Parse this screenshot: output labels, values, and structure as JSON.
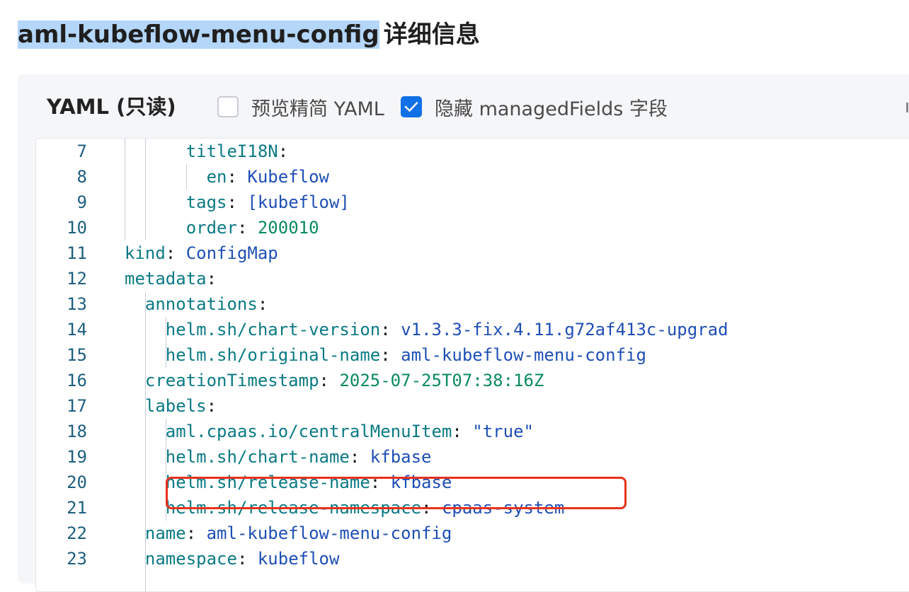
{
  "page": {
    "title_selected": "aml-kubeflow-menu-config",
    "title_rest": "详细信息"
  },
  "toolbar": {
    "yaml_title": "YAML (只读)",
    "preview_label": "预览精简 YAML",
    "preview_checked": false,
    "hide_label": "隐藏 managedFields 字段",
    "hide_checked": true
  },
  "colors": {
    "accent": "#1170e6",
    "highlight": "#e8321c",
    "selection": "#b4d6f8"
  },
  "code_lines": [
    {
      "num": "7",
      "indent": 3,
      "key": "titleI18N",
      "sep": ":",
      "value": "",
      "vtype": ""
    },
    {
      "num": "8",
      "indent": 4,
      "key": "en",
      "sep": ": ",
      "value": "Kubeflow",
      "vtype": "str"
    },
    {
      "num": "9",
      "indent": 3,
      "key": "tags",
      "sep": ": ",
      "value": "[kubeflow]",
      "vtype": "str"
    },
    {
      "num": "10",
      "indent": 3,
      "key": "order",
      "sep": ": ",
      "value": "200010",
      "vtype": "num"
    },
    {
      "num": "11",
      "indent": 0,
      "key": "kind",
      "sep": ": ",
      "value": "ConfigMap",
      "vtype": "str"
    },
    {
      "num": "12",
      "indent": 0,
      "key": "metadata",
      "sep": ":",
      "value": "",
      "vtype": ""
    },
    {
      "num": "13",
      "indent": 1,
      "key": "annotations",
      "sep": ":",
      "value": "",
      "vtype": ""
    },
    {
      "num": "14",
      "indent": 2,
      "key": "helm.sh/chart-version",
      "sep": ": ",
      "value": "v1.3.3-fix.4.11.g72af413c-upgrad",
      "vtype": "str"
    },
    {
      "num": "15",
      "indent": 2,
      "key": "helm.sh/original-name",
      "sep": ": ",
      "value": "aml-kubeflow-menu-config",
      "vtype": "str"
    },
    {
      "num": "16",
      "indent": 1,
      "key": "creationTimestamp",
      "sep": ": ",
      "value": "2025-07-25T07:38:16Z",
      "vtype": "num"
    },
    {
      "num": "17",
      "indent": 1,
      "key": "labels",
      "sep": ":",
      "value": "",
      "vtype": ""
    },
    {
      "num": "18",
      "indent": 2,
      "key": "aml.cpaas.io/centralMenuItem",
      "sep": ": ",
      "value": "\"true\"",
      "vtype": "str"
    },
    {
      "num": "19",
      "indent": 2,
      "key": "helm.sh/chart-name",
      "sep": ": ",
      "value": "kfbase",
      "vtype": "str"
    },
    {
      "num": "20",
      "indent": 2,
      "key": "helm.sh/release-name",
      "sep": ": ",
      "value": "kfbase",
      "vtype": "str"
    },
    {
      "num": "21",
      "indent": 2,
      "key": "helm.sh/release-namespace",
      "sep": ": ",
      "value": "cpaas-system",
      "vtype": "str"
    },
    {
      "num": "22",
      "indent": 1,
      "key": "name",
      "sep": ": ",
      "value": "aml-kubeflow-menu-config",
      "vtype": "str"
    },
    {
      "num": "23",
      "indent": 1,
      "key": "namespace",
      "sep": ": ",
      "value": "kubeflow",
      "vtype": "str"
    }
  ]
}
